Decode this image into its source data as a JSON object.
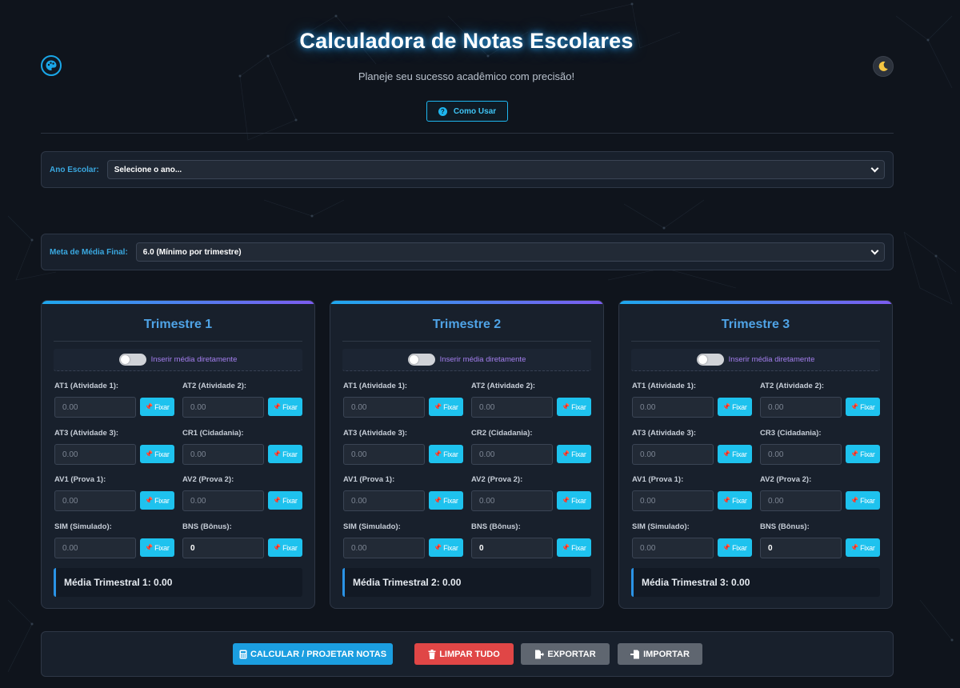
{
  "header": {
    "title": "Calculadora de Notas Escolares",
    "subtitle": "Planeje seu sucesso acadêmico com precisão!",
    "howto_label": "Como Usar"
  },
  "school_year": {
    "label": "Ano Escolar:",
    "value": "Selecione o ano..."
  },
  "goal": {
    "label": "Meta de Média Final:",
    "value": "6.0 (Mínimo por trimestre)"
  },
  "common": {
    "fix_label": "Fixar",
    "toggle_label": "Inserir média diretamente"
  },
  "trimesters": [
    {
      "title": "Trimestre 1",
      "fields": [
        {
          "label": "AT1 (Atividade 1):",
          "value": "0.00"
        },
        {
          "label": "AT2 (Atividade 2):",
          "value": "0.00"
        },
        {
          "label": "AT3 (Atividade 3):",
          "value": "0.00"
        },
        {
          "label": "CR1 (Cidadania):",
          "value": "0.00"
        },
        {
          "label": "AV1 (Prova 1):",
          "value": "0.00"
        },
        {
          "label": "AV2 (Prova 2):",
          "value": "0.00"
        },
        {
          "label": "SIM (Simulado):",
          "value": "0.00"
        },
        {
          "label": "BNS (Bônus):",
          "value": "0"
        }
      ],
      "average": "Média Trimestral 1: 0.00"
    },
    {
      "title": "Trimestre 2",
      "fields": [
        {
          "label": "AT1 (Atividade 1):",
          "value": "0.00"
        },
        {
          "label": "AT2 (Atividade 2):",
          "value": "0.00"
        },
        {
          "label": "AT3 (Atividade 3):",
          "value": "0.00"
        },
        {
          "label": "CR2 (Cidadania):",
          "value": "0.00"
        },
        {
          "label": "AV1 (Prova 1):",
          "value": "0.00"
        },
        {
          "label": "AV2 (Prova 2):",
          "value": "0.00"
        },
        {
          "label": "SIM (Simulado):",
          "value": "0.00"
        },
        {
          "label": "BNS (Bônus):",
          "value": "0"
        }
      ],
      "average": "Média Trimestral 2: 0.00"
    },
    {
      "title": "Trimestre 3",
      "fields": [
        {
          "label": "AT1 (Atividade 1):",
          "value": "0.00"
        },
        {
          "label": "AT2 (Atividade 2):",
          "value": "0.00"
        },
        {
          "label": "AT3 (Atividade 3):",
          "value": "0.00"
        },
        {
          "label": "CR3 (Cidadania):",
          "value": "0.00"
        },
        {
          "label": "AV1 (Prova 1):",
          "value": "0.00"
        },
        {
          "label": "AV2 (Prova 2):",
          "value": "0.00"
        },
        {
          "label": "SIM (Simulado):",
          "value": "0.00"
        },
        {
          "label": "BNS (Bônus):",
          "value": "0"
        }
      ],
      "average": "Média Trimestral 3: 0.00"
    }
  ],
  "actions": {
    "calculate": "CALCULAR / PROJETAR NOTAS",
    "clear": "LIMPAR TUDO",
    "export": "EXPORTAR",
    "import": "IMPORTAR"
  },
  "icons": {
    "theme_palette": "palette-icon",
    "dark_mode": "moon-icon",
    "help": "question-circle-icon",
    "pin": "pin-icon",
    "calculator": "calculator-icon",
    "trash": "trash-icon",
    "export": "file-export-icon",
    "import": "file-import-icon"
  },
  "colors": {
    "background": "#0f141c",
    "accent": "#1ec2ee",
    "title_glow": "#29aaff",
    "trimester_title": "#4fa3e6",
    "toggle_text": "#a57ff0",
    "danger": "#e04646",
    "neutral_button": "#5f6670"
  }
}
